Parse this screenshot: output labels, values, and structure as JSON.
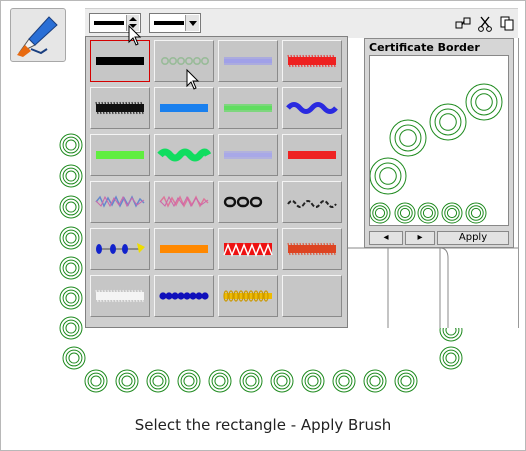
{
  "caption": "Select the rectangle - Apply Brush",
  "panel": {
    "title": "Certificate Border",
    "prev_icon": "◂",
    "next_icon": "▸",
    "apply_label": "Apply"
  },
  "toolbar": {
    "line_width_field": "line-width-selector",
    "line_style_field": "line-style-dropdown"
  },
  "brush_gallery": {
    "rows": 6,
    "cols": 4,
    "tiles": [
      {
        "name": "brush-black-solid",
        "style": "solid",
        "color": "#000000",
        "selected": true
      },
      {
        "name": "brush-green-circles",
        "style": "circles",
        "color": "#99bb99",
        "selected": false
      },
      {
        "name": "brush-lavender-soft",
        "style": "soft",
        "color": "#a0a0e8",
        "selected": false
      },
      {
        "name": "brush-red-fuzzy",
        "style": "fuzzy",
        "color": "#ee2020",
        "selected": false
      },
      {
        "name": "brush-black-fuzzy",
        "style": "fuzzy",
        "color": "#111111",
        "selected": false
      },
      {
        "name": "brush-blue-solid",
        "style": "solid",
        "color": "#1a80ee",
        "selected": false
      },
      {
        "name": "brush-green-soft",
        "style": "soft",
        "color": "#60dd60",
        "selected": false
      },
      {
        "name": "brush-blue-wavy",
        "style": "wavy",
        "color": "#2a2ae0",
        "selected": false
      },
      {
        "name": "brush-lime-solid",
        "style": "solid",
        "color": "#60ee40",
        "selected": false
      },
      {
        "name": "brush-green-bumpy",
        "style": "bumpy",
        "color": "#10dd60",
        "selected": false
      },
      {
        "name": "brush-lavender-thin",
        "style": "soft",
        "color": "#a8a8e8",
        "selected": false
      },
      {
        "name": "brush-red-solid",
        "style": "solid",
        "color": "#ee2222",
        "selected": false
      },
      {
        "name": "brush-multicolor-scribble",
        "style": "scribble",
        "color": "#6688cc",
        "selected": false
      },
      {
        "name": "brush-pink-scribble",
        "style": "scribble",
        "color": "#dd7799",
        "selected": false
      },
      {
        "name": "brush-chain",
        "style": "chain",
        "color": "#111111",
        "selected": false
      },
      {
        "name": "brush-black-wave",
        "style": "dashwave",
        "color": "#222222",
        "selected": false
      },
      {
        "name": "brush-dumbbell",
        "style": "dumbbell",
        "color": "#1122cc",
        "selected": false
      },
      {
        "name": "brush-orange-solid",
        "style": "solid",
        "color": "#ff8800",
        "selected": false
      },
      {
        "name": "brush-red-zigzag",
        "style": "zigzag",
        "color": "#ee1111",
        "selected": false
      },
      {
        "name": "brush-red-hatched",
        "style": "fuzzy",
        "color": "#dd4422",
        "selected": false
      },
      {
        "name": "brush-white-fuzzy",
        "style": "fuzzy",
        "color": "#f4f4f4",
        "selected": false
      },
      {
        "name": "brush-blue-beads",
        "style": "beads",
        "color": "#1010bb",
        "selected": false
      },
      {
        "name": "brush-gold-coil",
        "style": "coil",
        "color": "#eebb00",
        "selected": false
      },
      {
        "name": "brush-empty",
        "style": "empty",
        "color": "#d8d8d8",
        "selected": false
      }
    ]
  },
  "colors": {
    "ring_green": "#1e8a1e",
    "selection_red": "#d40000",
    "gallery_bg": "#cfcfcf"
  }
}
